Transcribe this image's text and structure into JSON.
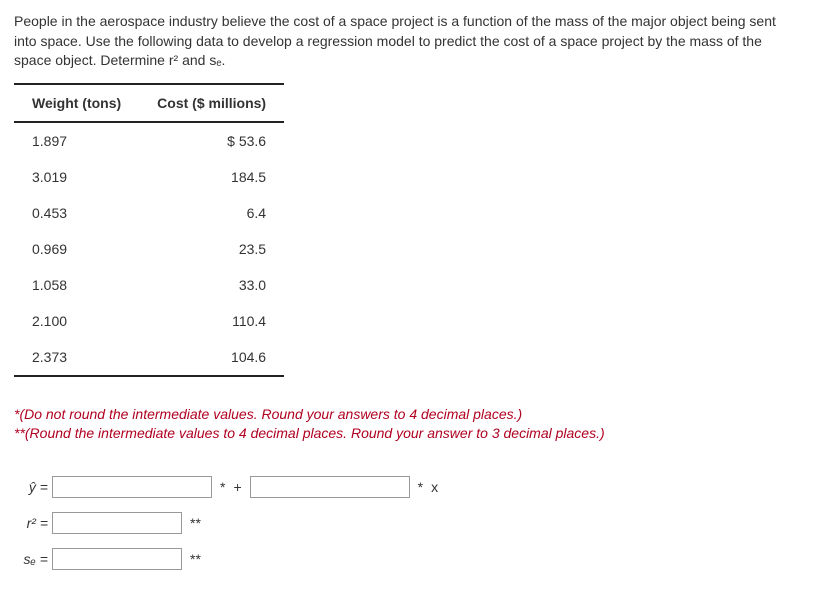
{
  "intro": {
    "text": "People in the aerospace industry believe the cost of a space project is a function of the mass of the major object being sent into space. Use the following data to develop a regression model to predict the cost of a space project by the mass of the space object. Determine r² and sₑ."
  },
  "table": {
    "headers": [
      "Weight (tons)",
      "Cost ($ millions)"
    ],
    "rows": [
      [
        "1.897",
        "$ 53.6"
      ],
      [
        "3.019",
        "184.5"
      ],
      [
        "0.453",
        "6.4"
      ],
      [
        "0.969",
        "23.5"
      ],
      [
        "1.058",
        "33.0"
      ],
      [
        "2.100",
        "110.4"
      ],
      [
        "2.373",
        "104.6"
      ]
    ]
  },
  "hints": {
    "line1": "*(Do not round the intermediate values. Round your answers to 4 decimal places.)",
    "line2": "**(Round the intermediate values to 4 decimal places. Round your answer to 3 decimal places.)"
  },
  "answers": {
    "yhat_label": "ŷ =",
    "yhat_mark1": "*",
    "yhat_plus": "+",
    "yhat_mark2": "*",
    "yhat_x": "x",
    "r2_label": "r² =",
    "r2_mark": "**",
    "se_label": "sₑ =",
    "se_mark": "**",
    "input_val": ""
  }
}
